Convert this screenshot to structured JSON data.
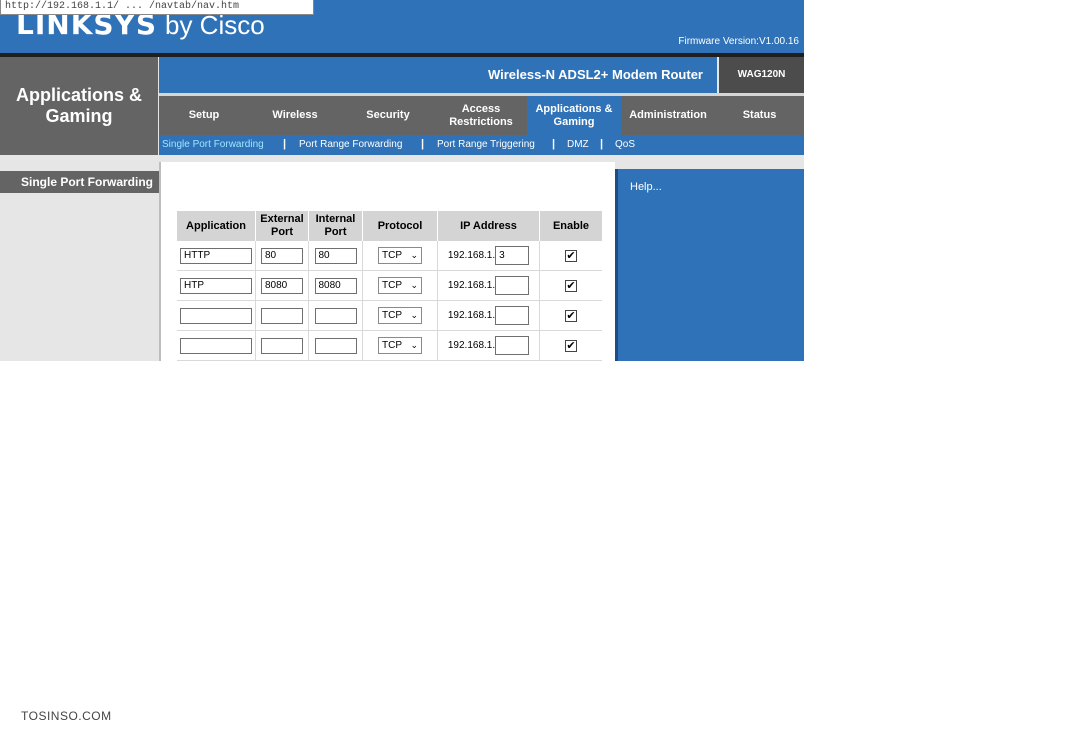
{
  "browser": {
    "url_fragment": "http://192.168.1.1/ ... /navtab/nav.htm"
  },
  "header": {
    "brand": "LINKSYS",
    "brand_suffix": "by Cisco",
    "firmware": "Firmware Version:V1.00.16",
    "section_title_line1": "Applications &",
    "section_title_line2": "Gaming",
    "product_name": "Wireless-N ADSL2+ Modem Router",
    "model": "WAG120N"
  },
  "tabs": [
    {
      "label": "Setup"
    },
    {
      "label": "Wireless"
    },
    {
      "label": "Security"
    },
    {
      "label_line1": "Access",
      "label_line2": "Restrictions"
    },
    {
      "label_line1": "Applications &",
      "label_line2": "Gaming",
      "active": true
    },
    {
      "label": "Administration"
    },
    {
      "label": "Status"
    }
  ],
  "subnav": [
    {
      "label": "Single Port Forwarding",
      "active": true
    },
    {
      "label": "Port Range Forwarding"
    },
    {
      "label": "Port Range Triggering"
    },
    {
      "label": "DMZ"
    },
    {
      "label": "QoS"
    }
  ],
  "subnav_separator": "|",
  "left_panel": {
    "title": "Single Port Forwarding"
  },
  "help": {
    "label": "Help..."
  },
  "table": {
    "headers": {
      "application": "Application",
      "external_line1": "External",
      "external_line2": "Port",
      "internal_line1": "Internal",
      "internal_line2": "Port",
      "protocol": "Protocol",
      "ip": "IP Address",
      "enable": "Enable"
    },
    "ip_prefix": "192.168.1.",
    "rows": [
      {
        "application": "HTTP",
        "external": "80",
        "internal": "80",
        "protocol": "TCP",
        "ip_last": "3",
        "enabled": true
      },
      {
        "application": "HTP",
        "external": "8080",
        "internal": "8080",
        "protocol": "TCP",
        "ip_last": "",
        "enabled": true
      },
      {
        "application": "",
        "external": "",
        "internal": "",
        "protocol": "TCP",
        "ip_last": "",
        "enabled": true
      },
      {
        "application": "",
        "external": "",
        "internal": "",
        "protocol": "TCP",
        "ip_last": "",
        "enabled": true
      }
    ]
  },
  "checkmark": "✔",
  "chevron": "⌄",
  "watermark": "TOSINSO.COM",
  "colors": {
    "blue": "#2f72b7",
    "gray": "#646464",
    "active_subnav": "#9fe6ff"
  }
}
